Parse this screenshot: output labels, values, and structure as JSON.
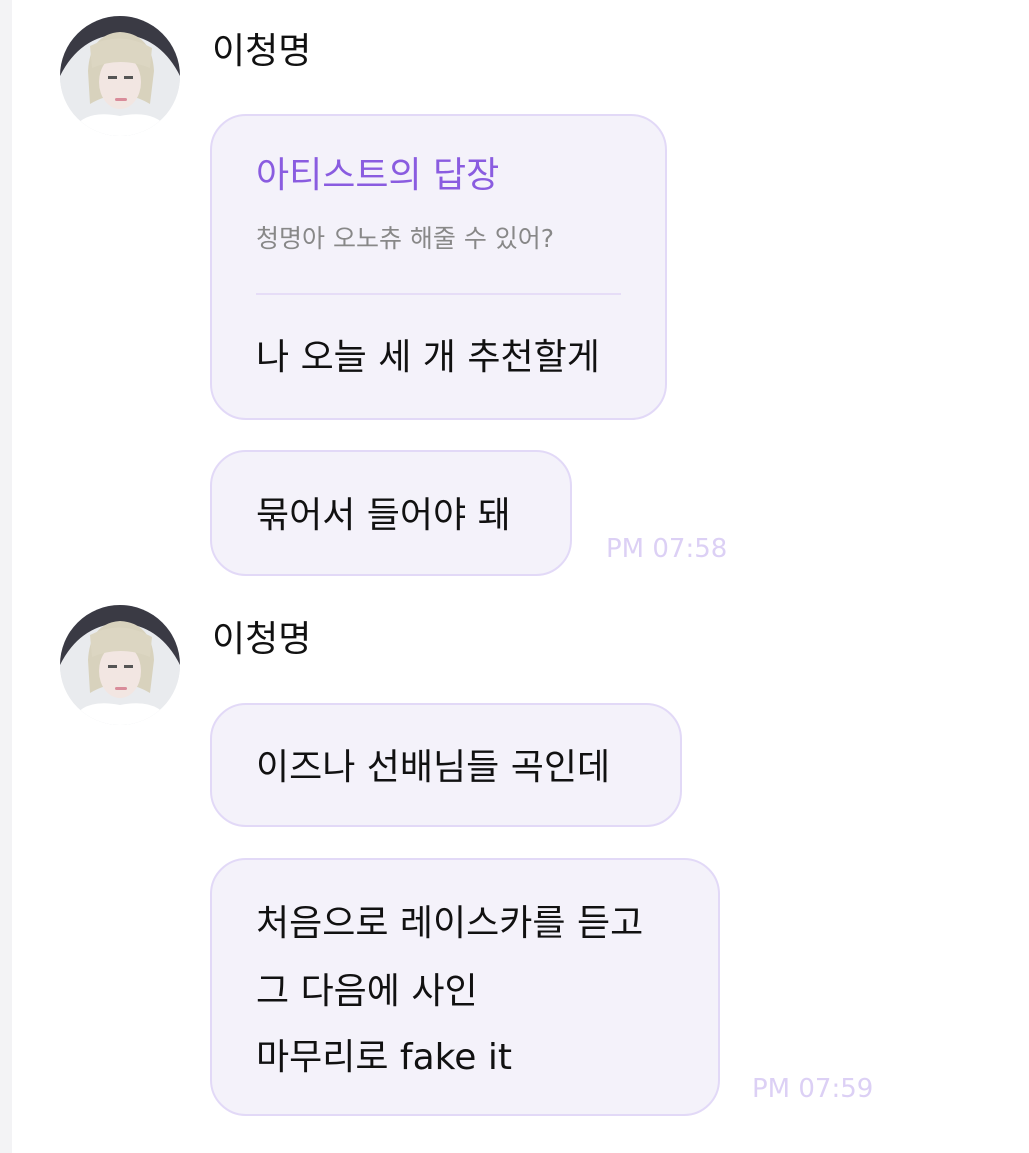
{
  "messages": [
    {
      "sender": "이청명",
      "reply": {
        "title": "아티스트의 답장",
        "quoted": "청명아 오노츄 해줄 수 있어?",
        "text": "나 오늘 세 개 추천할게"
      },
      "bubble2": "묶어서 들어야 돼",
      "time": "PM 07:58"
    },
    {
      "sender": "이청명",
      "bubble1": "이즈나 선배님들 곡인데",
      "lines": [
        "처음으로 레이스카를 듣고",
        "그 다음에 사인",
        "마무리로 fake it"
      ],
      "time": "PM 07:59"
    }
  ]
}
